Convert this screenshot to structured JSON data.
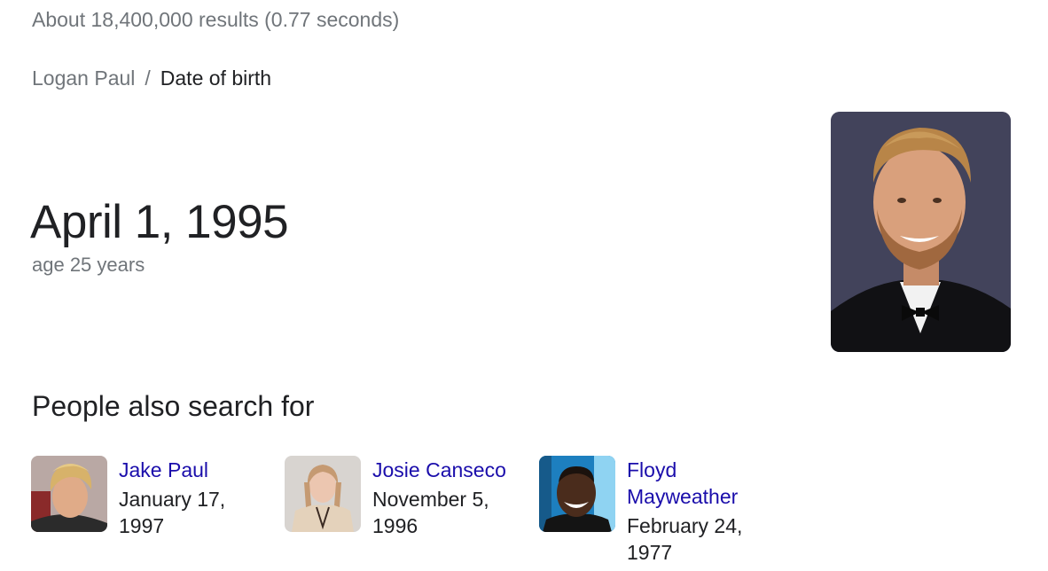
{
  "search": {
    "results_stats": "About 18,400,000 results (0.77 seconds)"
  },
  "breadcrumb": {
    "entity": "Logan Paul",
    "separator": "/",
    "attribute": "Date of birth"
  },
  "answer": {
    "value": "April 1, 1995",
    "subtext": "age 25 years"
  },
  "people_also_search": {
    "heading": "People also search for",
    "items": [
      {
        "name": "Jake Paul",
        "date": "January 17, 1997"
      },
      {
        "name": "Josie Canseco",
        "date": "November 5, 1996"
      },
      {
        "name": "Floyd Mayweather",
        "date": "February 24, 1977"
      }
    ]
  },
  "colors": {
    "link": "#1a0dab",
    "secondary_text": "#70757a",
    "primary_text": "#202124"
  }
}
